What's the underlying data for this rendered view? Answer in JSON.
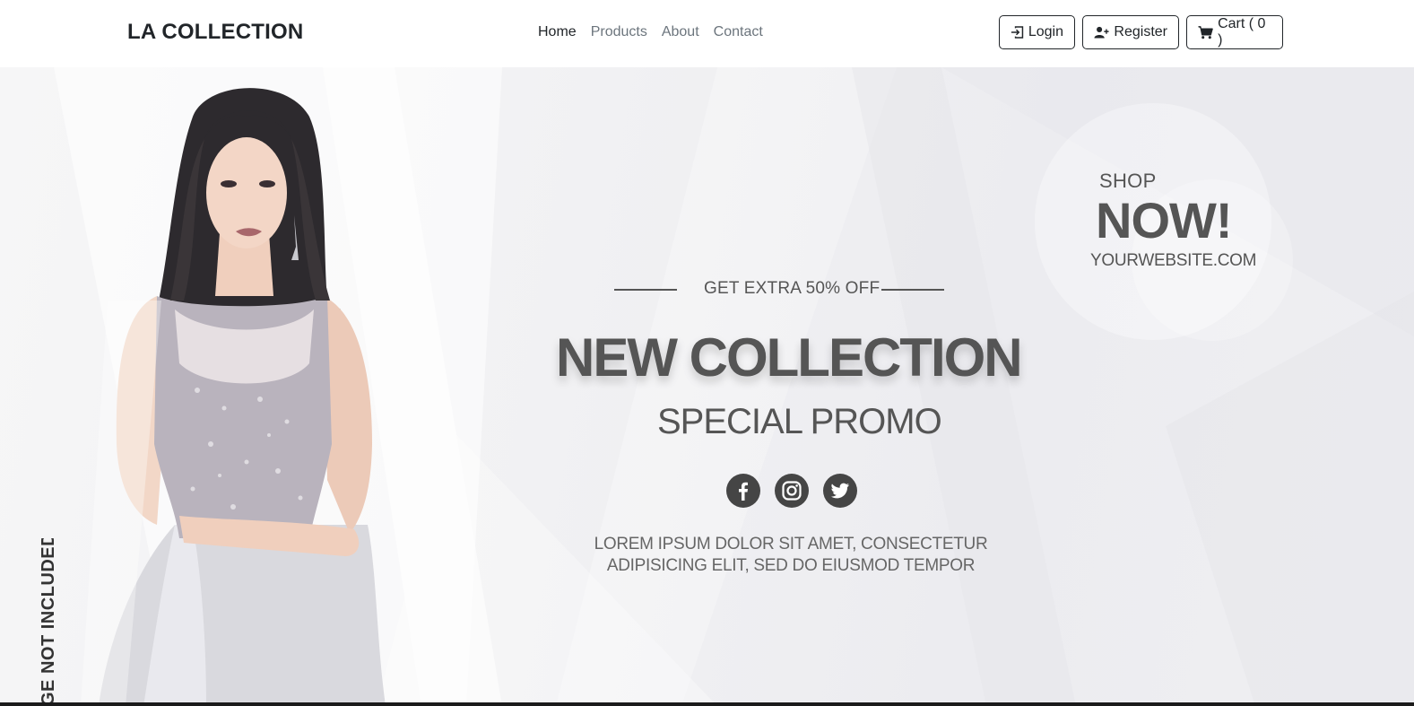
{
  "navbar": {
    "brand": "LA COLLECTION",
    "links": [
      {
        "label": "Home",
        "active": true
      },
      {
        "label": "Products",
        "active": false
      },
      {
        "label": "About",
        "active": false
      },
      {
        "label": "Contact",
        "active": false
      }
    ],
    "buttons": {
      "login": "Login",
      "register": "Register",
      "cart": "Cart ( 0 )"
    }
  },
  "hero": {
    "offer": "GET EXTRA 50% OFF",
    "title": "NEW COLLECTION",
    "subtitle": "SPECIAL PROMO",
    "description_line1": "LOREM IPSUM DOLOR SIT AMET, CONSECTETUR",
    "description_line2": "ADIPISICING ELIT, SED DO EIUSMOD TEMPOR",
    "vertical_text": "GE NOT INCLUDED",
    "shop": "SHOP",
    "now": "NOW!",
    "website": "YOURWEBSITE.COM",
    "socials": [
      "facebook-icon",
      "instagram-icon",
      "twitter-icon"
    ]
  },
  "colors": {
    "text_dark": "#212529",
    "text_muted": "#6c757d",
    "promo_gray": "#555555",
    "social_bg": "#454545"
  }
}
